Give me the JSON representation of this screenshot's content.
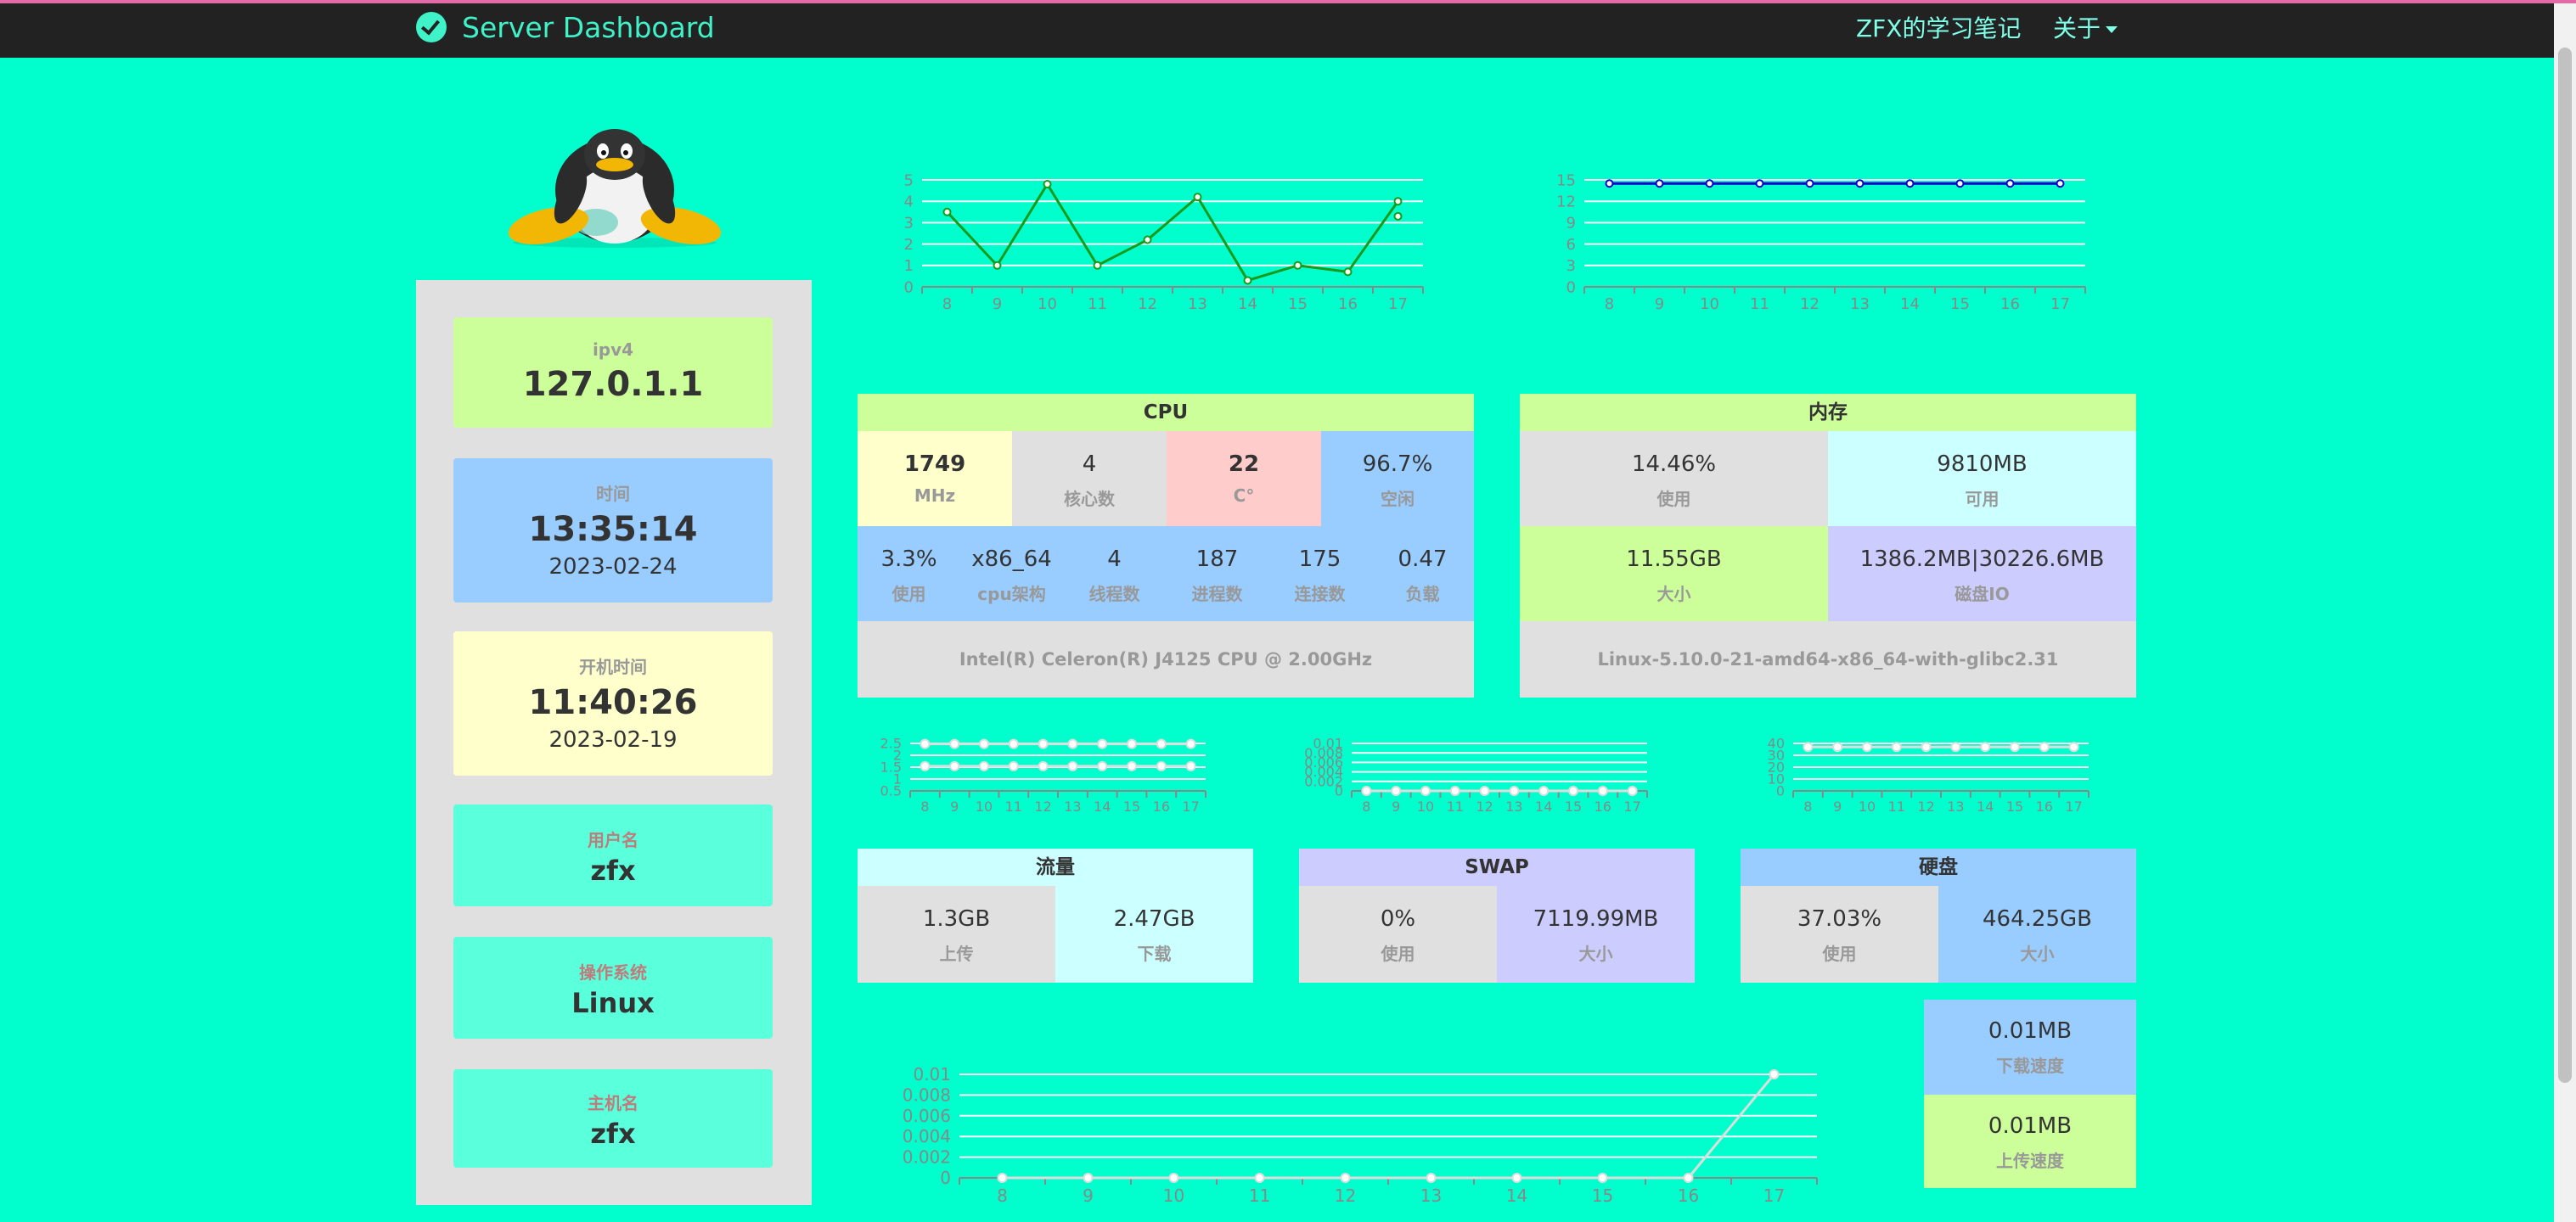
{
  "nav": {
    "brand": "Server Dashboard",
    "link_notes": "ZFX的学习笔记",
    "link_about": "关于"
  },
  "colors": {
    "background": "#00ffcc",
    "navbar": "#222222",
    "accent": "#3ff2c8"
  },
  "info": {
    "ipv4_label": "ipv4",
    "ipv4": "127.0.1.1",
    "time_label": "时间",
    "time": "13:35:14",
    "date": "2023-02-24",
    "boot_label": "开机时间",
    "boot_time": "11:40:26",
    "boot_date": "2023-02-19",
    "user_label": "用户名",
    "user": "zfx",
    "os_label": "操作系统",
    "os": "Linux",
    "host_label": "主机名",
    "host": "zfx"
  },
  "cpu": {
    "title": "CPU",
    "freq": "1749",
    "freq_unit": "MHz",
    "cores": "4",
    "cores_label": "核心数",
    "temp": "22",
    "temp_unit": "C°",
    "idle": "96.7%",
    "idle_label": "空闲",
    "use": "3.3%",
    "use_label": "使用",
    "arch": "x86_64",
    "arch_label": "cpu架构",
    "threads": "4",
    "threads_label": "线程数",
    "procs": "187",
    "procs_label": "进程数",
    "conns": "175",
    "conns_label": "连接数",
    "load": "0.47",
    "load_label": "负载",
    "model": "Intel(R) Celeron(R) J4125 CPU @ 2.00GHz"
  },
  "mem": {
    "title": "内存",
    "use": "14.46%",
    "use_label": "使用",
    "avail": "9810MB",
    "avail_label": "可用",
    "size": "11.55GB",
    "size_label": "大小",
    "io": "1386.2MB|30226.6MB",
    "io_label": "磁盘IO",
    "platform": "Linux-5.10.0-21-amd64-x86_64-with-glibc2.31"
  },
  "traffic": {
    "title": "流量",
    "up": "1.3GB",
    "up_label": "上传",
    "down": "2.47GB",
    "down_label": "下载"
  },
  "swap": {
    "title": "SWAP",
    "use": "0%",
    "use_label": "使用",
    "size": "7119.99MB",
    "size_label": "大小"
  },
  "disk": {
    "title": "硬盘",
    "use": "37.03%",
    "use_label": "使用",
    "size": "464.25GB",
    "size_label": "大小"
  },
  "speed": {
    "down": "0.01MB",
    "down_label": "下载速度",
    "up": "0.01MB",
    "up_label": "上传速度"
  },
  "chart_data": [
    {
      "id": "cpu-chart",
      "type": "line",
      "color": "#008000",
      "stroke": "#1a9a1a",
      "x": [
        8,
        9,
        10,
        11,
        12,
        13,
        14,
        15,
        16,
        17
      ],
      "ylim": [
        0,
        5
      ],
      "yticks": [
        "0",
        "1",
        "2",
        "3",
        "4",
        "5"
      ],
      "series": [
        {
          "values": [
            3.5,
            1,
            4.8,
            1,
            2.2,
            4.2,
            0.3,
            1,
            0.7,
            4
          ]
        }
      ],
      "extra_point": [
        17,
        3.3
      ]
    },
    {
      "id": "mem-chart",
      "type": "line",
      "color": "#0000cc",
      "stroke": "#0000cc",
      "x": [
        8,
        9,
        10,
        11,
        12,
        13,
        14,
        15,
        16,
        17
      ],
      "ylim": [
        0,
        15
      ],
      "yticks": [
        "0",
        "3",
        "6",
        "9",
        "12",
        "15"
      ],
      "series": [
        {
          "values": [
            14.5,
            14.5,
            14.5,
            14.5,
            14.5,
            14.5,
            14.5,
            14.5,
            14.5,
            14.5
          ]
        }
      ]
    },
    {
      "id": "traffic-chart",
      "type": "line",
      "color": "#dddddd",
      "stroke": "#dddddd",
      "x": [
        8,
        9,
        10,
        11,
        12,
        13,
        14,
        15,
        16,
        17
      ],
      "ylim": [
        0,
        2.5
      ],
      "yticks": [
        "0.5",
        "1",
        "1.5",
        "2",
        "2.5"
      ],
      "series": [
        {
          "values": [
            2.47,
            2.47,
            2.47,
            2.47,
            2.47,
            2.47,
            2.47,
            2.47,
            2.47,
            2.47
          ]
        },
        {
          "values": [
            1.3,
            1.3,
            1.3,
            1.3,
            1.3,
            1.3,
            1.3,
            1.3,
            1.3,
            1.3
          ]
        }
      ]
    },
    {
      "id": "swap-chart",
      "type": "line",
      "color": "#dddddd",
      "stroke": "#dddddd",
      "x": [
        8,
        9,
        10,
        11,
        12,
        13,
        14,
        15,
        16,
        17
      ],
      "ylim": [
        0,
        0.01
      ],
      "yticks": [
        "0",
        "0.002",
        "0.004",
        "0.006",
        "0.008",
        "0.01"
      ],
      "series": [
        {
          "values": [
            0,
            0,
            0,
            0,
            0,
            0,
            0,
            0,
            0,
            0
          ]
        }
      ]
    },
    {
      "id": "disk-chart",
      "type": "line",
      "color": "#dddddd",
      "stroke": "#dddddd",
      "x": [
        8,
        9,
        10,
        11,
        12,
        13,
        14,
        15,
        16,
        17
      ],
      "ylim": [
        0,
        40
      ],
      "yticks": [
        "0",
        "10",
        "20",
        "30",
        "40"
      ],
      "series": [
        {
          "values": [
            37,
            37,
            37,
            37,
            37,
            37,
            37,
            37,
            37,
            37
          ]
        }
      ]
    },
    {
      "id": "speed-chart",
      "type": "line",
      "color": "#dddddd",
      "stroke": "#dddddd",
      "x": [
        8,
        9,
        10,
        11,
        12,
        13,
        14,
        15,
        16,
        17
      ],
      "ylim": [
        0,
        0.01
      ],
      "yticks": [
        "0",
        "0.002",
        "0.004",
        "0.006",
        "0.008",
        "0.01"
      ],
      "series": [
        {
          "values": [
            0,
            0,
            0,
            0,
            0,
            0,
            0,
            0,
            0,
            0.01
          ]
        }
      ]
    }
  ]
}
